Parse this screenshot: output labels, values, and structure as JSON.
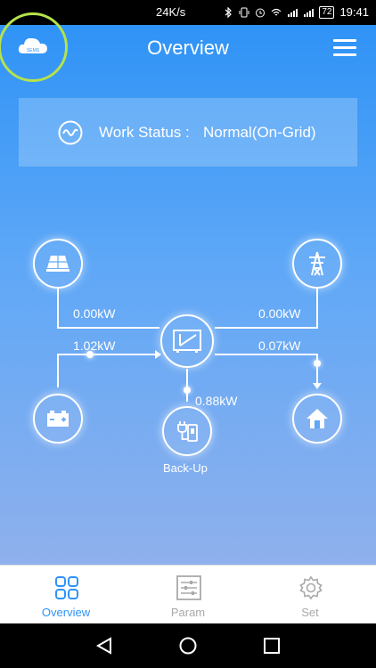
{
  "statusbar": {
    "speed": "24K/s",
    "battery": "72",
    "time": "19:41"
  },
  "header": {
    "title": "Overview",
    "logo_text": "SEMS"
  },
  "work_status": {
    "label": "Work Status :",
    "value": "Normal(On-Grid)"
  },
  "flow": {
    "pv_power": "0.00kW",
    "grid_power": "0.00kW",
    "battery_power": "1.02kW",
    "load_power": "0.07kW",
    "backup_power": "0.88kW",
    "backup_label": "Back-Up"
  },
  "tabs": [
    {
      "label": "Overview",
      "active": true
    },
    {
      "label": "Param",
      "active": false
    },
    {
      "label": "Set",
      "active": false
    }
  ],
  "colors": {
    "accent": "#2f93f6",
    "ring": "#b5e34a",
    "inactive": "#a9a9a9"
  }
}
